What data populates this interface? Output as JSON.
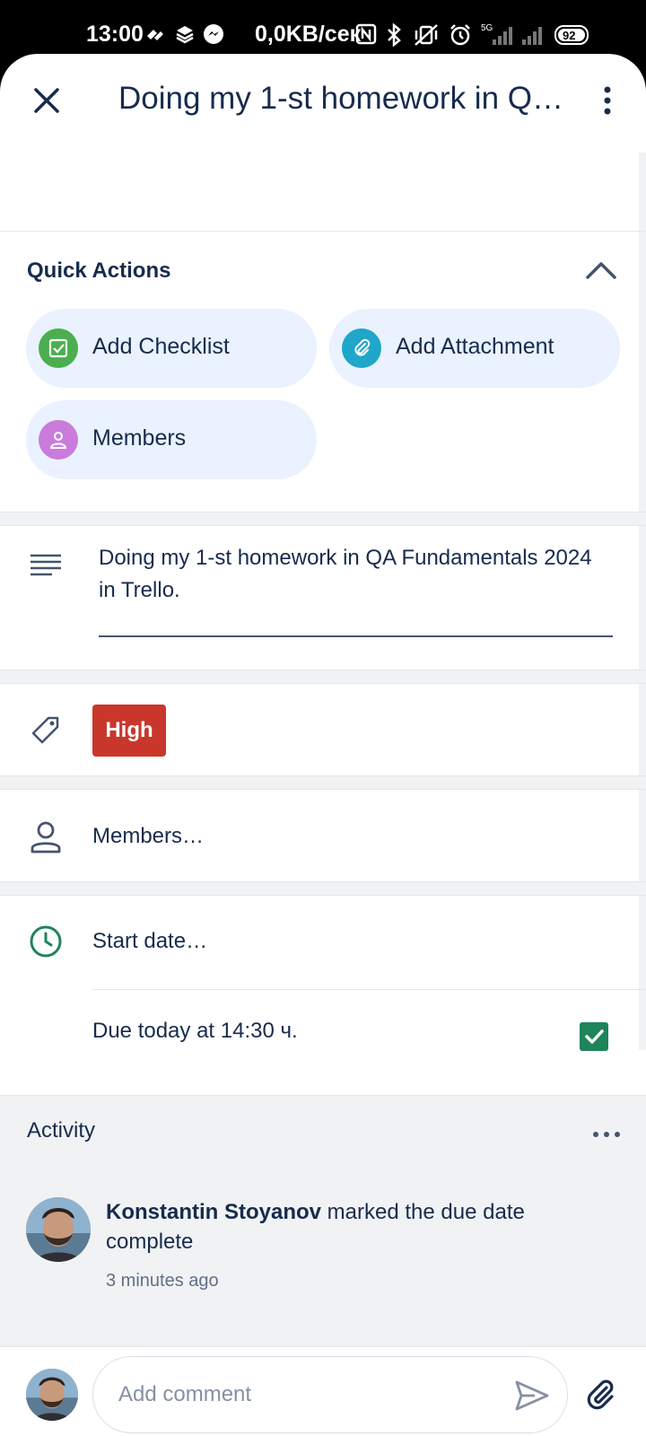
{
  "status_bar": {
    "time": "13:00",
    "network_speed": "0,0KB/сек",
    "battery": "92",
    "network_type": "5G"
  },
  "header": {
    "title": "Doing my 1-st homework in QA Fundamentals 2024 in Trello."
  },
  "quick_actions": {
    "title": "Quick Actions",
    "add_checklist": "Add Checklist",
    "add_attachment": "Add Attachment",
    "members": "Members"
  },
  "description": {
    "text": "Doing my 1-st homework in QA Fundamentals 2024 in Trello."
  },
  "labels": {
    "priority": "High",
    "priority_color": "#c9372c"
  },
  "members_row": {
    "placeholder": "Members…"
  },
  "dates": {
    "start_placeholder": "Start date…",
    "due_text": "Due today at 14:30 ч.",
    "due_complete": true
  },
  "activity": {
    "title": "Activity",
    "entries": [
      {
        "user": "Konstantin Stoyanov",
        "action": " marked the due date complete",
        "time": "3 minutes ago"
      }
    ]
  },
  "comment": {
    "placeholder": "Add comment"
  },
  "colors": {
    "text": "#172b4d",
    "chip_bg": "#e9f2fe",
    "checklist_icon": "#4bae4f",
    "attachment_icon": "#1fa6c9",
    "members_icon": "#c97cdb",
    "clock_icon": "#1f845a",
    "due_check": "#1f845a"
  }
}
